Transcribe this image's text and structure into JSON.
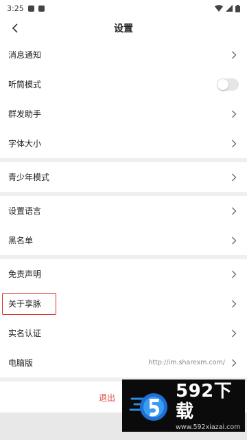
{
  "status_bar": {
    "time": "3:25"
  },
  "navbar": {
    "title": "设置",
    "back_icon": "chevron-left-icon"
  },
  "groups": [
    {
      "items": [
        {
          "label": "消息通知",
          "type": "link"
        },
        {
          "label": "听筒模式",
          "type": "toggle",
          "toggle_on": false
        },
        {
          "label": "群发助手",
          "type": "link"
        },
        {
          "label": "字体大小",
          "type": "link"
        }
      ]
    },
    {
      "items": [
        {
          "label": "青少年模式",
          "type": "link"
        }
      ]
    },
    {
      "items": [
        {
          "label": "设置语言",
          "type": "link"
        },
        {
          "label": "黑名单",
          "type": "link"
        }
      ]
    },
    {
      "items": [
        {
          "label": "免责声明",
          "type": "link"
        },
        {
          "label": "关于享脉",
          "type": "link",
          "highlighted": true
        },
        {
          "label": "实名认证",
          "type": "link"
        },
        {
          "label": "电脑版",
          "type": "link",
          "value": "http://im.sharexm.com/"
        }
      ]
    }
  ],
  "logout_label": "退出",
  "watermark": {
    "title": "592下载",
    "url": "www.592xiazai.com"
  },
  "colors": {
    "accent_red": "#e0463f",
    "highlight_border": "#d9302c",
    "separator": "#efefef"
  }
}
